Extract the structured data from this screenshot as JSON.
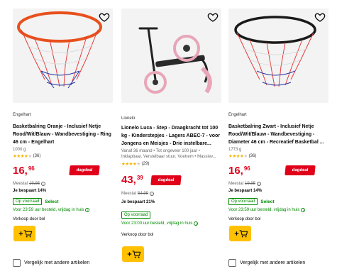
{
  "colors": {
    "accent": "#e0001a",
    "stock": "#008a00",
    "cart": "#ffc100"
  },
  "products": [
    {
      "brand": "Engelhart",
      "title": "Basketbalring Oranje - Inclusief Netje Rood/Wit/Blauw - Wandbevestiging - Ring 46 cm - Engelhart",
      "weight": "1000 g",
      "rating_stars": 4,
      "reviews": "(36)",
      "price_whole": "16,",
      "price_cents": "96",
      "deal_label": "dagdeal",
      "meestal_label": "Meestal",
      "old_price": "19,95",
      "savings": "Je bespaart 14%",
      "stock_label": "Op voorraad",
      "select_label": "Select",
      "delivery": "Voor 23:59 uur besteld, vrijdag in huis",
      "seller": "Verkoop door bol",
      "compare": "Vergelijk met andere artikelen",
      "favorite_icon": "heart-icon",
      "cart_icon": "add-to-cart-icon"
    },
    {
      "brand": "Lionelo",
      "title": "Lionelo Luca - Step - Draagkracht tot 100 kg - Kinderstepjes - Lagers ABEC-7 - voor Jongens en Meisjes - Drie instelbare...",
      "spec1": "Vanaf 36 maand • Tot ongeveer 100 jaar •",
      "spec2": "Inklapbaar, Verstelbaar stuur, Voetrem • Massiev...",
      "rating_stars": 3.5,
      "reviews": "(29)",
      "price_whole": "43,",
      "price_cents": "39",
      "deal_label": "dagdeal",
      "meestal_label": "Meestal",
      "old_price": "54,99",
      "savings": "Je bespaart 21%",
      "stock_label": "Op voorraad",
      "delivery": "Voor 23:00 uur besteld, vrijdag in huis",
      "seller": "Verkoop door bol",
      "favorite_icon": "heart-icon",
      "cart_icon": "add-to-cart-icon"
    },
    {
      "brand": "Engelhart",
      "title": "Basketbalring Zwart - Inclusief Netje Rood/Wit/Blauw - Wandbevestiging - Diameter 46 cm - Recreatief Basketbal ...",
      "weight": "1773 g",
      "rating_stars": 4,
      "reviews": "(36)",
      "price_whole": "16,",
      "price_cents": "96",
      "deal_label": "dagdeal",
      "meestal_label": "Meestal",
      "old_price": "19,95",
      "savings": "Je bespaart 14%",
      "stock_label": "Op voorraad",
      "select_label": "Select",
      "delivery": "Voor 23:59 uur besteld, vrijdag in huis",
      "seller": "Verkoop door bol",
      "compare": "Vergelijk met andere artikelen",
      "favorite_icon": "heart-icon",
      "cart_icon": "add-to-cart-icon"
    }
  ]
}
